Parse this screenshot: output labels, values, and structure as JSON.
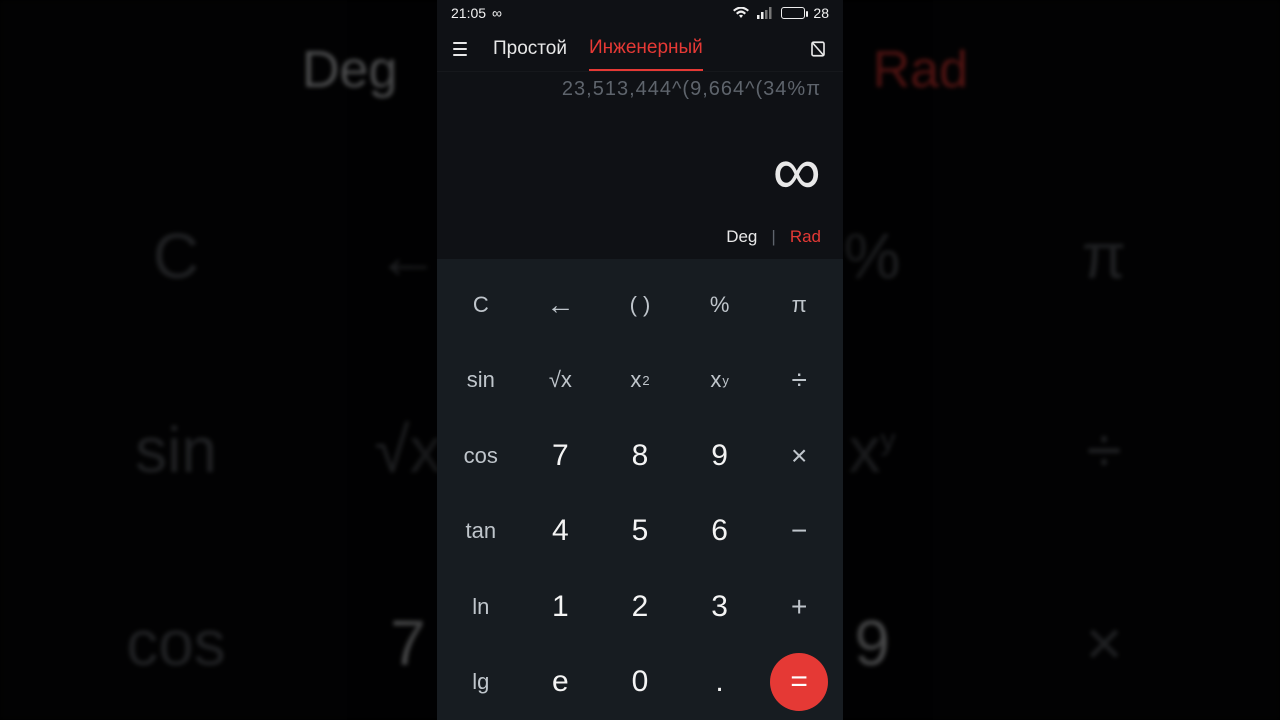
{
  "status": {
    "time": "21:05",
    "infinity": "∞",
    "battery": "28"
  },
  "header": {
    "tab_simple": "Простой",
    "tab_engineer": "Инженерный"
  },
  "display": {
    "expression": "23,513,444^(9,664^(34%π",
    "result": "∞"
  },
  "angle": {
    "deg": "Deg",
    "rad": "Rad"
  },
  "keys": {
    "clear": "C",
    "back": "←",
    "paren": "( )",
    "percent": "%",
    "pi": "π",
    "sin": "sin",
    "sqrt": "√x",
    "sq_base": "x",
    "sq_exp": "2",
    "pow_base": "x",
    "pow_exp": "y",
    "div": "÷",
    "cos": "cos",
    "k7": "7",
    "k8": "8",
    "k9": "9",
    "mul": "×",
    "tan": "tan",
    "k4": "4",
    "k5": "5",
    "k6": "6",
    "sub": "−",
    "ln": "ln",
    "k1": "1",
    "k2": "2",
    "k3": "3",
    "add": "+",
    "lg": "lg",
    "e": "e",
    "k0": "0",
    "dot": ".",
    "eq": "="
  },
  "backdrop": {
    "r0": {
      "c0": "Deg",
      "c4": "Rad"
    },
    "r1": {
      "c0": "C",
      "c1": "←",
      "c3": "%",
      "c4": "π"
    },
    "r2": {
      "c0": "sin",
      "c1": "√x",
      "c3x": "x",
      "c3y": "y",
      "c4": "÷"
    },
    "r3": {
      "c0": "cos",
      "c1": "7",
      "c3": "9",
      "c4": "×"
    }
  }
}
